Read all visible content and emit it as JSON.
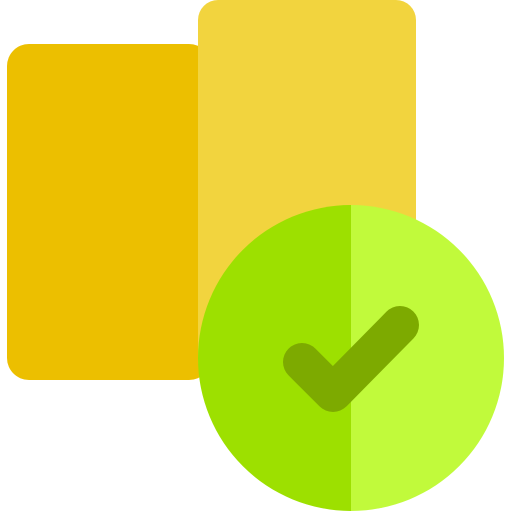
{
  "icon": {
    "name": "documents-approved-icon",
    "colors": {
      "back_card": "#ECBF00",
      "front_card": "#F2D43E",
      "badge_left": "#9DE000",
      "badge_right": "#C1FA3B",
      "check": "#7DAA00"
    }
  }
}
